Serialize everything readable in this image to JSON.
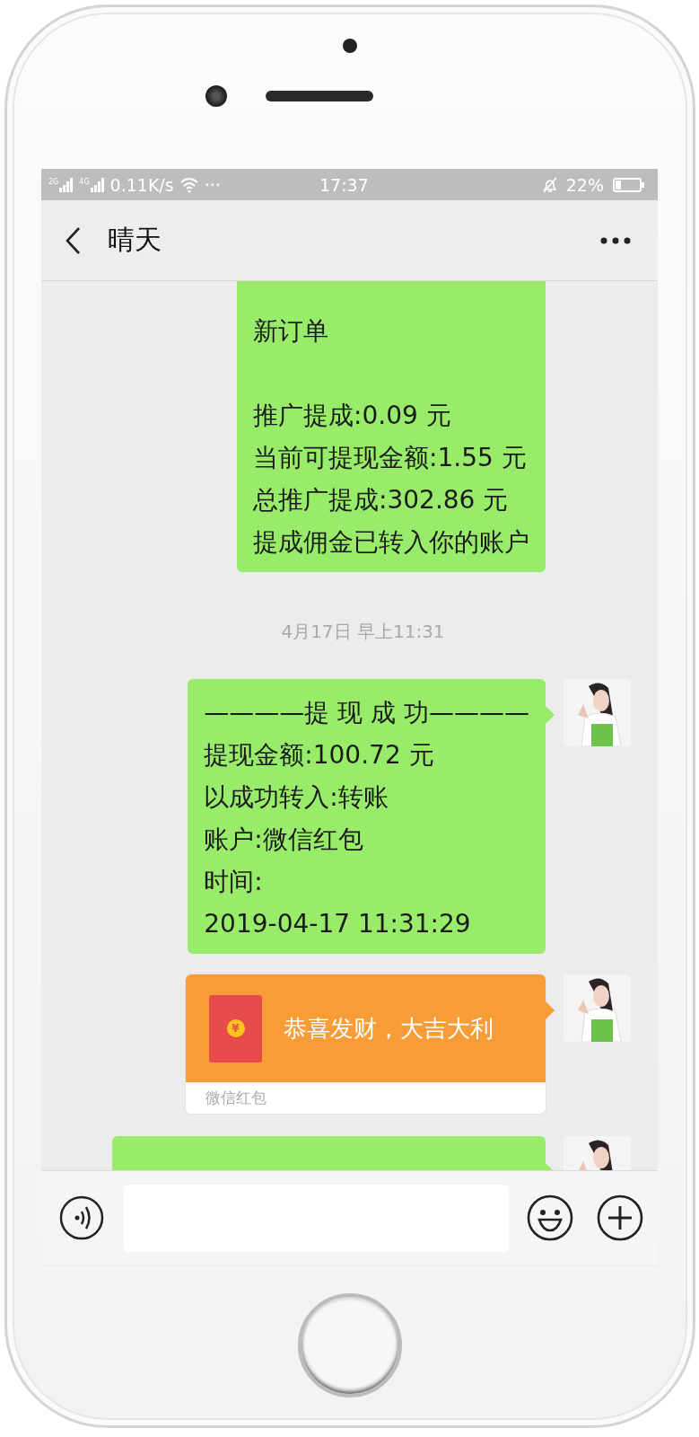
{
  "status_bar": {
    "network_1": "2G",
    "network_2": "4G",
    "speed": "0.11K/s",
    "more": "···",
    "time": "17:37",
    "battery": "22%"
  },
  "header": {
    "title": "晴天"
  },
  "messages": [
    {
      "kind": "text",
      "avatar": false,
      "paragraphs": [
        [
          "新订单"
        ],
        [
          "推广提成:0.09 元",
          "当前可提现金额:1.55 元",
          "总推广提成:302.86 元",
          "提成佣金已转入你的账户"
        ]
      ]
    },
    {
      "kind": "time",
      "text": "4月17日 早上11:31"
    },
    {
      "kind": "text",
      "avatar": true,
      "paragraphs": [
        [
          "————提 现 成 功————",
          "提现金额:100.72 元",
          "以成功转入:转账",
          "账户:微信红包",
          "时间:",
          "2019-04-17 11:31:29"
        ]
      ]
    },
    {
      "kind": "red_packet",
      "avatar": true,
      "coin": "¥",
      "greeting": "恭喜发财，大吉大利",
      "label": "微信红包"
    },
    {
      "kind": "text",
      "avatar": true
    }
  ]
}
